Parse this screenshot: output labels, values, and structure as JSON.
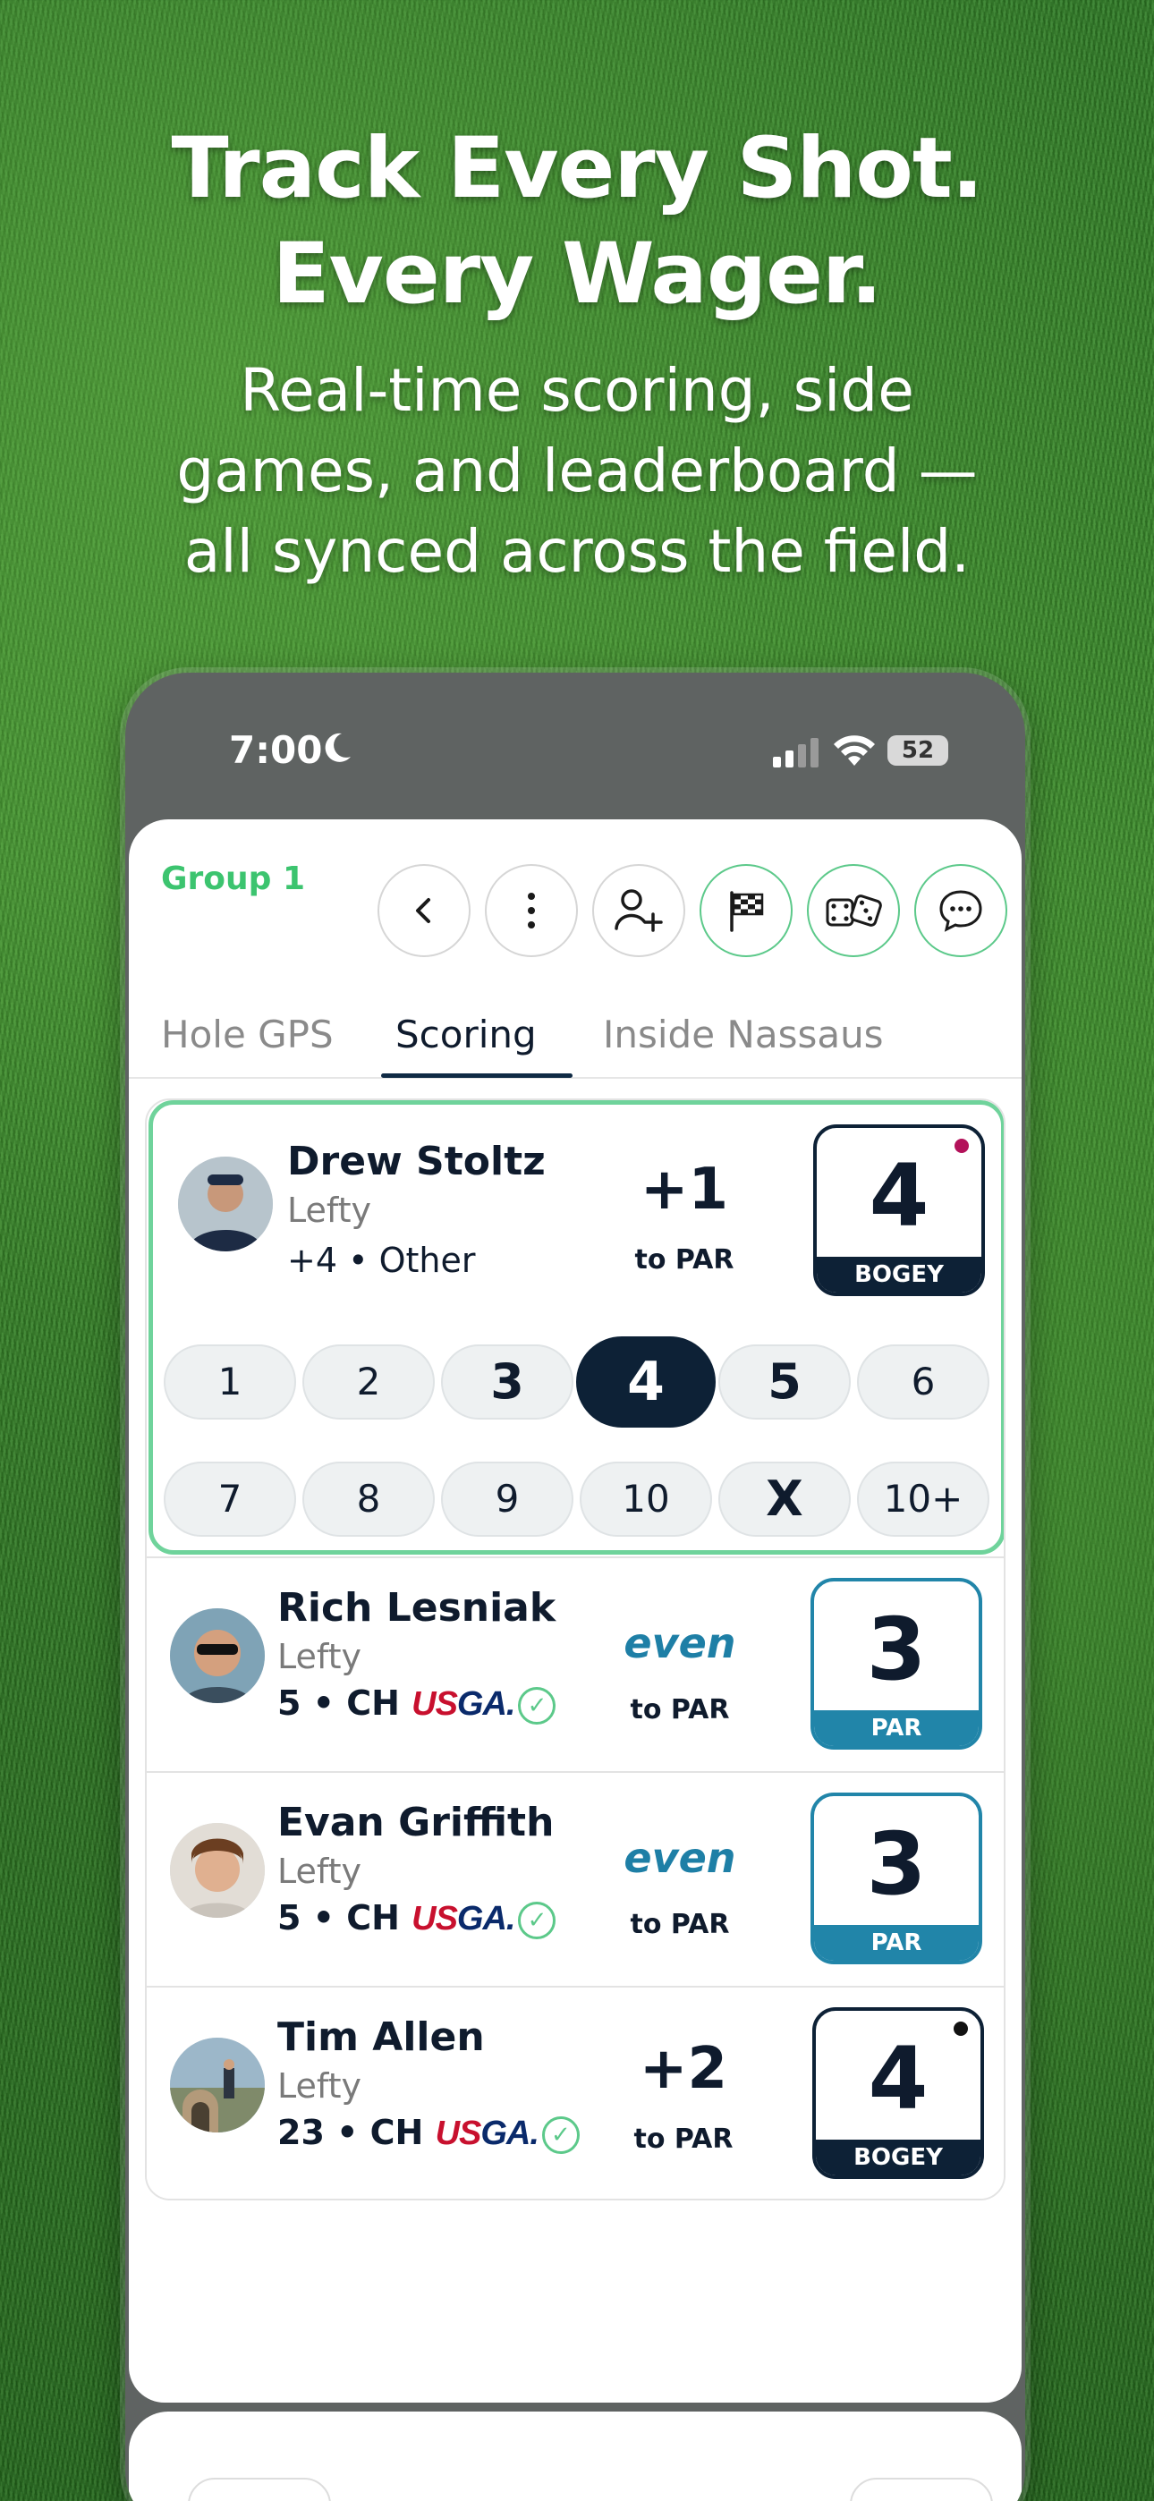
{
  "marketing": {
    "headline_line1": "Track Every Shot.",
    "headline_line2": "Every Wager.",
    "sub_line1": "Real-time scoring, side",
    "sub_line2": "games, and leaderboard —",
    "sub_line3": "all synced across the field."
  },
  "status": {
    "time": "7:00",
    "battery": "52"
  },
  "header": {
    "group_title": "Group 1"
  },
  "tabs": [
    {
      "label": "Hole GPS"
    },
    {
      "label": "Scoring"
    },
    {
      "label": "Inside Nassaus"
    }
  ],
  "active_tab": "Scoring",
  "players": [
    {
      "name": "Drew Stoltz",
      "hand": "Lefty",
      "meta": "+4  •  Other",
      "to_par": "+1",
      "to_par_label": "to PAR",
      "score": "4",
      "score_label": "BOGEY",
      "score_dot_color": "#b3125a"
    },
    {
      "name": "Rich Lesniak",
      "hand": "Lefty",
      "meta": "5 • CH",
      "to_par": "even",
      "to_par_label": "to PAR",
      "score": "3",
      "score_label": "PAR"
    },
    {
      "name": "Evan Griffith",
      "hand": "Lefty",
      "meta": "5 • CH",
      "to_par": "even",
      "to_par_label": "to PAR",
      "score": "3",
      "score_label": "PAR"
    },
    {
      "name": "Tim Allen",
      "hand": "Lefty",
      "meta": "23 • CH",
      "to_par": "+2",
      "to_par_label": "to PAR",
      "score": "4",
      "score_label": "BOGEY",
      "score_dot_color": "#111111"
    }
  ],
  "usga": {
    "us": "US",
    "ga": "GA",
    "dot": "."
  },
  "score_pad": {
    "row1": [
      "1",
      "2",
      "3",
      "4",
      "5",
      "6"
    ],
    "row2": [
      "7",
      "8",
      "9",
      "10",
      "X",
      "10+"
    ],
    "selected": "4"
  },
  "colors": {
    "accent_green": "#3cc46f",
    "navy": "#0d2136",
    "par_blue": "#2185a9",
    "usga_red": "#c8102e"
  },
  "icons": [
    "back-icon",
    "more-icon",
    "add-player-icon",
    "flag-icon",
    "dice-icon",
    "chat-icon"
  ]
}
